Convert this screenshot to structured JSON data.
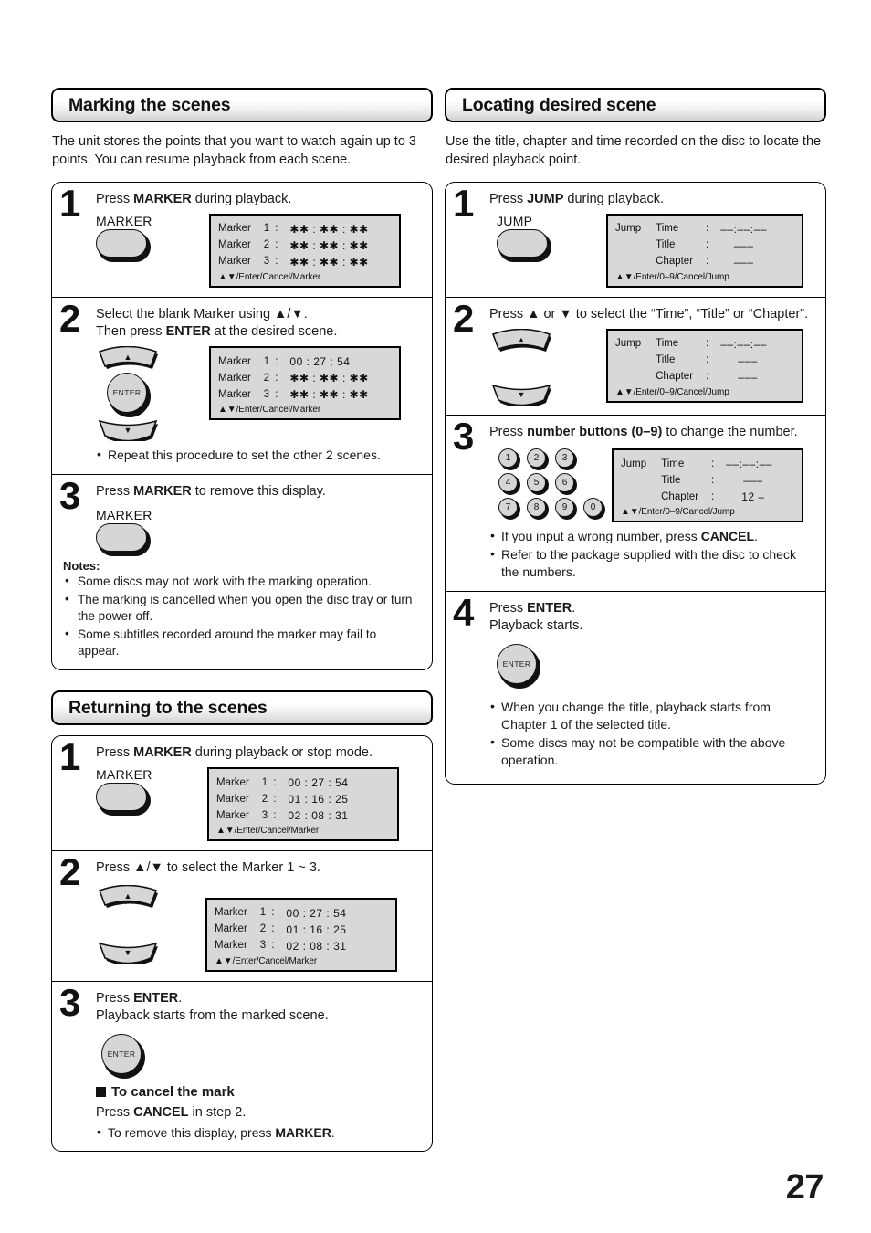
{
  "page": {
    "number": "27"
  },
  "left_column": {
    "section1": {
      "title": "Marking the scenes",
      "intro": "The unit stores the points that you want to watch again up to 3 points. You can resume playback from each scene.",
      "steps": [
        {
          "num": "1",
          "text_html": "Press <b>MARKER</b> during playback.",
          "button_label": "MARKER",
          "osd": {
            "rows": [
              {
                "label": "Marker",
                "index": "1",
                "colon": ":",
                "value": "✱✱ : ✱✱ : ✱✱",
                "highlight": true
              },
              {
                "label": "Marker",
                "index": "2",
                "colon": ":",
                "value": "✱✱ : ✱✱ : ✱✱",
                "highlight": false
              },
              {
                "label": "Marker",
                "index": "3",
                "colon": ":",
                "value": "✱✱ : ✱✱ : ✱✱",
                "highlight": false
              }
            ],
            "hint": "▲▼/Enter/Cancel/Marker"
          }
        },
        {
          "num": "2",
          "text_html": "Select the blank Marker using <b>▲</b>/<b>▼</b>.<br>Then press <b>ENTER</b> at the desired scene.",
          "enter_label": "ENTER",
          "osd": {
            "rows": [
              {
                "label": "Marker",
                "index": "1",
                "colon": ":",
                "value": "00 : 27 : 54",
                "highlight": true
              },
              {
                "label": "Marker",
                "index": "2",
                "colon": ":",
                "value": "✱✱ : ✱✱ : ✱✱",
                "highlight": false
              },
              {
                "label": "Marker",
                "index": "3",
                "colon": ":",
                "value": "✱✱ : ✱✱ : ✱✱",
                "highlight": false
              }
            ],
            "hint": "▲▼/Enter/Cancel/Marker"
          },
          "bullets": [
            "Repeat this procedure to set the other 2 scenes."
          ]
        },
        {
          "num": "3",
          "text_html": "Press <b>MARKER</b> to remove this display.",
          "button_label": "MARKER",
          "notes_title": "Notes:",
          "notes": [
            "Some discs may not work with the  marking operation.",
            "The marking is cancelled when you open the disc tray or turn the power off.",
            "Some subtitles recorded around the marker may fail to appear."
          ]
        }
      ]
    },
    "section2": {
      "title": "Returning to the scenes",
      "steps": [
        {
          "num": "1",
          "text_html": "Press <b>MARKER</b> during playback or stop mode.",
          "button_label": "MARKER",
          "osd": {
            "rows": [
              {
                "label": "Marker",
                "index": "1",
                "colon": ":",
                "value": "00 : 27 : 54",
                "highlight": true
              },
              {
                "label": "Marker",
                "index": "2",
                "colon": ":",
                "value": "01 : 16 : 25",
                "highlight": false
              },
              {
                "label": "Marker",
                "index": "3",
                "colon": ":",
                "value": "02 : 08 : 31",
                "highlight": false
              }
            ],
            "hint": "▲▼/Enter/Cancel/Marker"
          }
        },
        {
          "num": "2",
          "text_html": "Press <b>▲</b>/<b>▼</b> to select the Marker 1 ~ 3.",
          "osd": {
            "rows": [
              {
                "label": "Marker",
                "index": "1",
                "colon": ":",
                "value": "00 : 27 : 54",
                "highlight": false
              },
              {
                "label": "Marker",
                "index": "2",
                "colon": ":",
                "value": "01 : 16 : 25",
                "highlight": true
              },
              {
                "label": "Marker",
                "index": "3",
                "colon": ":",
                "value": "02 : 08 : 31",
                "highlight": false
              }
            ],
            "hint": "▲▼/Enter/Cancel/Marker"
          }
        },
        {
          "num": "3",
          "text_html": "Press <b>ENTER</b>.<br>Playback starts from the marked scene.",
          "enter_label": "ENTER",
          "sub_head": "To cancel the mark",
          "sub_text_html": "Press <b>CANCEL</b> in step 2.",
          "bullets_html": [
            "To remove this display, press <b>MARKER</b>."
          ]
        }
      ]
    }
  },
  "right_column": {
    "section1": {
      "title": "Locating desired scene",
      "intro": "Use the title, chapter and time recorded on the disc to locate the desired playback point.",
      "steps": [
        {
          "num": "1",
          "text_html": "Press <b>JUMP</b> during playback.",
          "button_label": "JUMP",
          "osd": {
            "mode_label": "Jump",
            "rows": [
              {
                "label": "Time",
                "colon": ":",
                "value": "––:––:––",
                "highlight": true
              },
              {
                "label": "Title",
                "colon": ":",
                "value": "–––",
                "highlight": false
              },
              {
                "label": "Chapter",
                "colon": ":",
                "value": "–––",
                "highlight": false
              }
            ],
            "hint": "▲▼/Enter/0–9/Cancel/Jump"
          }
        },
        {
          "num": "2",
          "text_html": "Press <b>▲</b> or <b>▼</b> to select the “Time”, “Title” or “Chapter”.",
          "osd": {
            "mode_label": "Jump",
            "rows": [
              {
                "label": "Time",
                "colon": ":",
                "value": "––:––:––",
                "highlight": false
              },
              {
                "label": "Title",
                "colon": ":",
                "value": "–––",
                "highlight": false
              },
              {
                "label": "Chapter",
                "colon": ":",
                "value": "–––",
                "highlight": true
              }
            ],
            "hint": "▲▼/Enter/0–9/Cancel/Jump"
          }
        },
        {
          "num": "3",
          "text_html": "Press <b>number buttons (0–9)</b> to change the number.",
          "numpad": [
            "1",
            "2",
            "3",
            "4",
            "5",
            "6",
            "7",
            "8",
            "9",
            "0"
          ],
          "osd": {
            "mode_label": "Jump",
            "rows": [
              {
                "label": "Time",
                "colon": ":",
                "value": "––:––:––",
                "highlight": false
              },
              {
                "label": "Title",
                "colon": ":",
                "value": "–––",
                "highlight": false
              },
              {
                "label": "Chapter",
                "colon": ":",
                "value": "12 –",
                "highlight": true
              }
            ],
            "hint": "▲▼/Enter/0–9/Cancel/Jump"
          },
          "bullets_html": [
            "If you input a wrong number, press <b>CANCEL</b>.",
            "Refer to the package supplied with the disc to check the numbers."
          ]
        },
        {
          "num": "4",
          "text_html": "Press <b>ENTER</b>.<br>Playback starts.",
          "enter_label": "ENTER",
          "bullets_html": [
            "When you change the title, playback starts from Chapter 1 of the selected title.",
            "Some discs may not be compatible with the above operation."
          ]
        }
      ]
    }
  }
}
